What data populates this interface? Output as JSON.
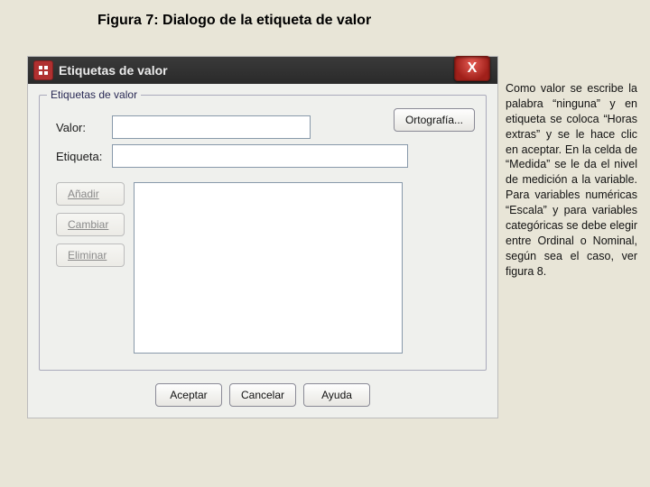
{
  "figure_caption": "Figura 7: Dialogo de la etiqueta de valor",
  "titlebar": {
    "title": "Etiquetas de valor"
  },
  "close_glyph": "X",
  "groupbox": {
    "legend": "Etiquetas de valor"
  },
  "labels": {
    "valor": "Valor:",
    "etiqueta": "Etiqueta:"
  },
  "inputs": {
    "valor": "",
    "etiqueta": ""
  },
  "buttons": {
    "ortografia": "Ortografía...",
    "anadir": "Añadir",
    "cambiar": "Cambiar",
    "eliminar": "Eliminar",
    "aceptar": "Aceptar",
    "cancelar": "Cancelar",
    "ayuda": "Ayuda"
  },
  "explain": "Como valor se escribe la palabra “ninguna” y en etiqueta se coloca “Horas extras” y se le hace clic en aceptar. En la celda de “Medida” se le da el nivel de medición a la variable. Para variables numéricas “Escala” y para variables categóricas se debe elegir entre Ordinal o Nominal, según sea el caso, ver figura 8."
}
